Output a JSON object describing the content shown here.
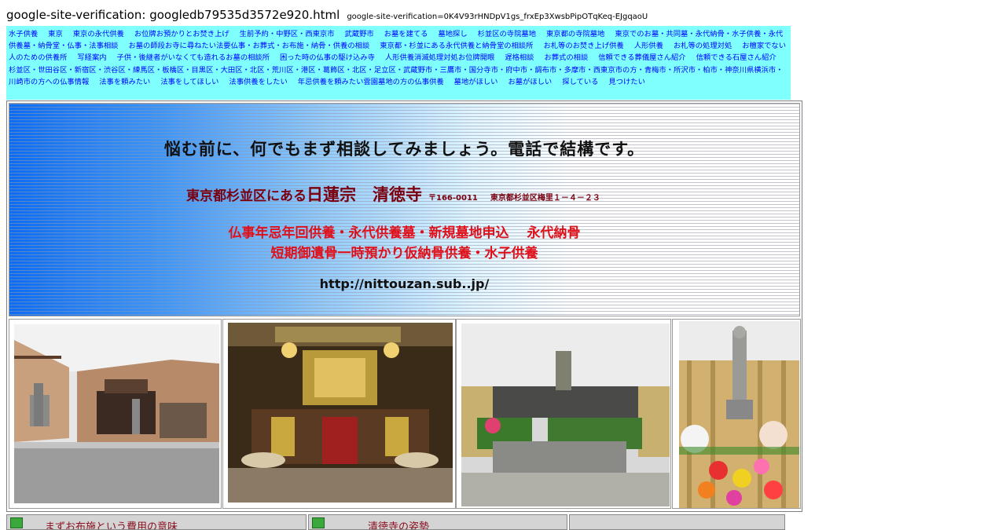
{
  "header": {
    "verification_file": "google-site-verification: googledb79535d3572e920.html",
    "verification_meta": "google-site-verification=0K4V93rHNDpV1gs_frxEp3XwsbPipOTqKeq-EJgqaoU"
  },
  "nav_links": [
    "水子供養",
    "東京",
    "東京の永代供養",
    "お位牌お預かりとお焚き上げ",
    "生前予約・中野区・西東京市",
    "武蔵野市",
    "お墓を建てる",
    "墓地探し",
    "杉並区の寺院墓地",
    "東京都の寺院墓地",
    "東京でのお墓・共同墓・永代納骨・水子供養・永代供養墓・納骨堂・仏事・法事相談",
    "お墓の師段お寺に尋ねたい法要仏事・お葬式・お布施・納骨・供養の相談",
    "東京都・杉並にある永代供養と納骨堂の相談所",
    "お札等のお焚き上げ供養",
    "人形供養",
    "お札等の処理対処",
    "お檀家でない人のための供養所",
    "写経案内",
    "子供・後継者がいなくても造れるお墓の相談所",
    "困った時の仏事の駆け込み寺",
    "人形供養消滅処理対処お位牌開眼",
    "遅格相談",
    "お葬式の相談",
    "信頼できる葬儀屋さん紹介",
    "信頼できる石屋さん紹介",
    "杉並区・世田谷区・新宿区・渋谷区・練馬区・板橋区・目黒区・大田区・北区・荒川区・港区・葛飾区・北区・足立区・武蔵野市・三鷹市・国分寺市・府中市・調布市・多摩市・西東京市の方・青梅市・所沢市・柏市・神奈川県横浜市・川崎市の方への仏事情報",
    "法事を頼みたい",
    "法事をしてほしい",
    "法事供養をしたい",
    "年忌供養を頼みたい雲園墓地の方の仏事供養",
    "墓地がほしい",
    "お墓がほしい",
    "探している",
    "見つけたい"
  ],
  "banner": {
    "headline": "悩む前に、何でもまず相談してみましょう。電話で結構です。",
    "location": "東京都杉並区にある",
    "temple": "日蓮宗　清徳寺",
    "postal": "〒166-0011",
    "address": "東京都杉並区梅里１－４－２３",
    "services_line1": "仏事年忌年回供養・永代供養墓・新規墓地申込　 永代納骨",
    "services_line2": "短期御遺骨一時預かり仮納骨供養・水子供養",
    "url": "http://nittouzan.sub..jp/"
  },
  "bottom_bar": {
    "item1": "まずお布施という費用の意味",
    "item2": "清徳寺の姿勢"
  },
  "colors": {
    "nav_bg": "#80ffff",
    "link": "#0000ff",
    "temple_text": "#7a0010",
    "services_text": "#e0101a"
  }
}
